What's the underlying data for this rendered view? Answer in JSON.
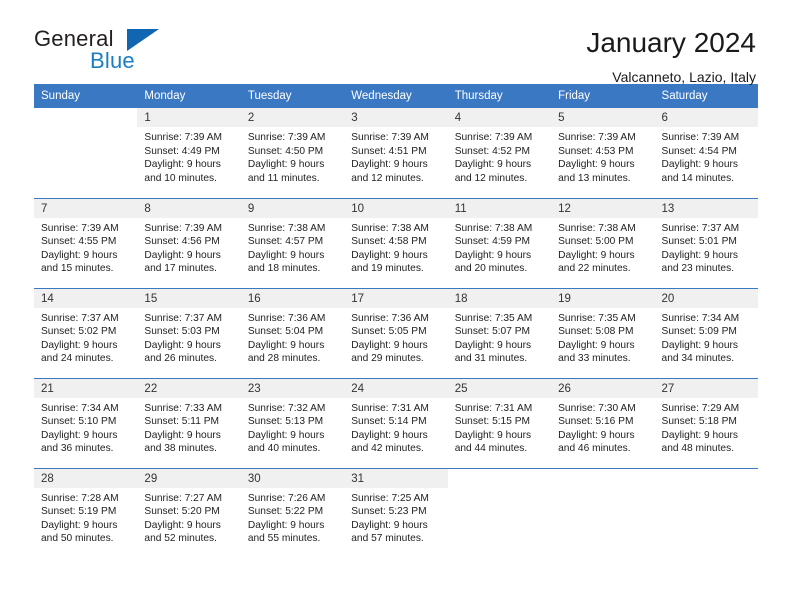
{
  "brand": {
    "name_top": "General",
    "name_bottom": "Blue",
    "triangle_icon": "triangle-icon",
    "color_dark": "#231f20",
    "color_blue": "#1b7ec2"
  },
  "header": {
    "title": "January 2024",
    "subtitle": "Valcanneto, Lazio, Italy"
  },
  "theme": {
    "accent": "#3b78c3",
    "daynum_band": "#f0f0f0",
    "text": "#1a1a1a"
  },
  "calendar": {
    "weekday_headers": [
      "Sunday",
      "Monday",
      "Tuesday",
      "Wednesday",
      "Thursday",
      "Friday",
      "Saturday"
    ],
    "weeks": [
      [
        {
          "day": "",
          "sunrise": "",
          "sunset": "",
          "daylight_1": "",
          "daylight_2": ""
        },
        {
          "day": "1",
          "sunrise": "Sunrise: 7:39 AM",
          "sunset": "Sunset: 4:49 PM",
          "daylight_1": "Daylight: 9 hours",
          "daylight_2": "and 10 minutes."
        },
        {
          "day": "2",
          "sunrise": "Sunrise: 7:39 AM",
          "sunset": "Sunset: 4:50 PM",
          "daylight_1": "Daylight: 9 hours",
          "daylight_2": "and 11 minutes."
        },
        {
          "day": "3",
          "sunrise": "Sunrise: 7:39 AM",
          "sunset": "Sunset: 4:51 PM",
          "daylight_1": "Daylight: 9 hours",
          "daylight_2": "and 12 minutes."
        },
        {
          "day": "4",
          "sunrise": "Sunrise: 7:39 AM",
          "sunset": "Sunset: 4:52 PM",
          "daylight_1": "Daylight: 9 hours",
          "daylight_2": "and 12 minutes."
        },
        {
          "day": "5",
          "sunrise": "Sunrise: 7:39 AM",
          "sunset": "Sunset: 4:53 PM",
          "daylight_1": "Daylight: 9 hours",
          "daylight_2": "and 13 minutes."
        },
        {
          "day": "6",
          "sunrise": "Sunrise: 7:39 AM",
          "sunset": "Sunset: 4:54 PM",
          "daylight_1": "Daylight: 9 hours",
          "daylight_2": "and 14 minutes."
        }
      ],
      [
        {
          "day": "7",
          "sunrise": "Sunrise: 7:39 AM",
          "sunset": "Sunset: 4:55 PM",
          "daylight_1": "Daylight: 9 hours",
          "daylight_2": "and 15 minutes."
        },
        {
          "day": "8",
          "sunrise": "Sunrise: 7:39 AM",
          "sunset": "Sunset: 4:56 PM",
          "daylight_1": "Daylight: 9 hours",
          "daylight_2": "and 17 minutes."
        },
        {
          "day": "9",
          "sunrise": "Sunrise: 7:38 AM",
          "sunset": "Sunset: 4:57 PM",
          "daylight_1": "Daylight: 9 hours",
          "daylight_2": "and 18 minutes."
        },
        {
          "day": "10",
          "sunrise": "Sunrise: 7:38 AM",
          "sunset": "Sunset: 4:58 PM",
          "daylight_1": "Daylight: 9 hours",
          "daylight_2": "and 19 minutes."
        },
        {
          "day": "11",
          "sunrise": "Sunrise: 7:38 AM",
          "sunset": "Sunset: 4:59 PM",
          "daylight_1": "Daylight: 9 hours",
          "daylight_2": "and 20 minutes."
        },
        {
          "day": "12",
          "sunrise": "Sunrise: 7:38 AM",
          "sunset": "Sunset: 5:00 PM",
          "daylight_1": "Daylight: 9 hours",
          "daylight_2": "and 22 minutes."
        },
        {
          "day": "13",
          "sunrise": "Sunrise: 7:37 AM",
          "sunset": "Sunset: 5:01 PM",
          "daylight_1": "Daylight: 9 hours",
          "daylight_2": "and 23 minutes."
        }
      ],
      [
        {
          "day": "14",
          "sunrise": "Sunrise: 7:37 AM",
          "sunset": "Sunset: 5:02 PM",
          "daylight_1": "Daylight: 9 hours",
          "daylight_2": "and 24 minutes."
        },
        {
          "day": "15",
          "sunrise": "Sunrise: 7:37 AM",
          "sunset": "Sunset: 5:03 PM",
          "daylight_1": "Daylight: 9 hours",
          "daylight_2": "and 26 minutes."
        },
        {
          "day": "16",
          "sunrise": "Sunrise: 7:36 AM",
          "sunset": "Sunset: 5:04 PM",
          "daylight_1": "Daylight: 9 hours",
          "daylight_2": "and 28 minutes."
        },
        {
          "day": "17",
          "sunrise": "Sunrise: 7:36 AM",
          "sunset": "Sunset: 5:05 PM",
          "daylight_1": "Daylight: 9 hours",
          "daylight_2": "and 29 minutes."
        },
        {
          "day": "18",
          "sunrise": "Sunrise: 7:35 AM",
          "sunset": "Sunset: 5:07 PM",
          "daylight_1": "Daylight: 9 hours",
          "daylight_2": "and 31 minutes."
        },
        {
          "day": "19",
          "sunrise": "Sunrise: 7:35 AM",
          "sunset": "Sunset: 5:08 PM",
          "daylight_1": "Daylight: 9 hours",
          "daylight_2": "and 33 minutes."
        },
        {
          "day": "20",
          "sunrise": "Sunrise: 7:34 AM",
          "sunset": "Sunset: 5:09 PM",
          "daylight_1": "Daylight: 9 hours",
          "daylight_2": "and 34 minutes."
        }
      ],
      [
        {
          "day": "21",
          "sunrise": "Sunrise: 7:34 AM",
          "sunset": "Sunset: 5:10 PM",
          "daylight_1": "Daylight: 9 hours",
          "daylight_2": "and 36 minutes."
        },
        {
          "day": "22",
          "sunrise": "Sunrise: 7:33 AM",
          "sunset": "Sunset: 5:11 PM",
          "daylight_1": "Daylight: 9 hours",
          "daylight_2": "and 38 minutes."
        },
        {
          "day": "23",
          "sunrise": "Sunrise: 7:32 AM",
          "sunset": "Sunset: 5:13 PM",
          "daylight_1": "Daylight: 9 hours",
          "daylight_2": "and 40 minutes."
        },
        {
          "day": "24",
          "sunrise": "Sunrise: 7:31 AM",
          "sunset": "Sunset: 5:14 PM",
          "daylight_1": "Daylight: 9 hours",
          "daylight_2": "and 42 minutes."
        },
        {
          "day": "25",
          "sunrise": "Sunrise: 7:31 AM",
          "sunset": "Sunset: 5:15 PM",
          "daylight_1": "Daylight: 9 hours",
          "daylight_2": "and 44 minutes."
        },
        {
          "day": "26",
          "sunrise": "Sunrise: 7:30 AM",
          "sunset": "Sunset: 5:16 PM",
          "daylight_1": "Daylight: 9 hours",
          "daylight_2": "and 46 minutes."
        },
        {
          "day": "27",
          "sunrise": "Sunrise: 7:29 AM",
          "sunset": "Sunset: 5:18 PM",
          "daylight_1": "Daylight: 9 hours",
          "daylight_2": "and 48 minutes."
        }
      ],
      [
        {
          "day": "28",
          "sunrise": "Sunrise: 7:28 AM",
          "sunset": "Sunset: 5:19 PM",
          "daylight_1": "Daylight: 9 hours",
          "daylight_2": "and 50 minutes."
        },
        {
          "day": "29",
          "sunrise": "Sunrise: 7:27 AM",
          "sunset": "Sunset: 5:20 PM",
          "daylight_1": "Daylight: 9 hours",
          "daylight_2": "and 52 minutes."
        },
        {
          "day": "30",
          "sunrise": "Sunrise: 7:26 AM",
          "sunset": "Sunset: 5:22 PM",
          "daylight_1": "Daylight: 9 hours",
          "daylight_2": "and 55 minutes."
        },
        {
          "day": "31",
          "sunrise": "Sunrise: 7:25 AM",
          "sunset": "Sunset: 5:23 PM",
          "daylight_1": "Daylight: 9 hours",
          "daylight_2": "and 57 minutes."
        },
        {
          "day": "",
          "sunrise": "",
          "sunset": "",
          "daylight_1": "",
          "daylight_2": ""
        },
        {
          "day": "",
          "sunrise": "",
          "sunset": "",
          "daylight_1": "",
          "daylight_2": ""
        },
        {
          "day": "",
          "sunrise": "",
          "sunset": "",
          "daylight_1": "",
          "daylight_2": ""
        }
      ]
    ]
  }
}
